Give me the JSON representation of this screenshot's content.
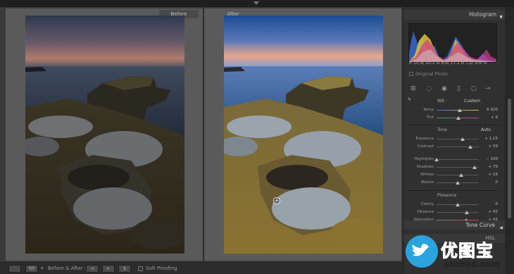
{
  "canvas": {
    "before_label": "Before",
    "after_label": "After"
  },
  "toolbar": {
    "view_mode_icon": "loupe-view-icon",
    "yy_label": "Y|Y",
    "before_after_label": "Before & After :",
    "swap_icons": [
      "copy-before-to-after-icon",
      "copy-after-to-before-icon",
      "swap-icon"
    ],
    "soft_proofing_label": "Soft Proofing"
  },
  "panel": {
    "histogram_title": "Histogram",
    "readout": "R  10,9/ 20,1  G  9,9/ 17,1  B  7,2/  9,6  %",
    "original_photo": "Original Photo",
    "wb_label": "WB :",
    "wb_value": "Custom",
    "temp_label": "Temp",
    "temp_value": "6 920",
    "tint_label": "Tint",
    "tint_value": "+ 9",
    "tone_title": "Tone",
    "tone_auto": "Auto",
    "exposure_label": "Exposure",
    "exposure_value": "+ 1,15",
    "contrast_label": "Contrast",
    "contrast_value": "+ 59",
    "highlights_label": "Highlights",
    "highlights_value": "− 100",
    "shadows_label": "Shadows",
    "shadows_value": "+ 79",
    "whites_label": "Whites",
    "whites_value": "+ 16",
    "blacks_label": "Blacks",
    "blacks_value": "0",
    "presence_title": "Presence",
    "clarity_label": "Clarity",
    "clarity_value": "0",
    "vibrance_label": "Vibrance",
    "vibrance_value": "+ 42",
    "saturation_label": "Saturation",
    "saturation_value": "+ 41",
    "tone_curve_title": "Tone Curve",
    "hsl_title": "HSL"
  },
  "sliders": {
    "temp": 0.55,
    "tint": 0.52,
    "exposure": 0.62,
    "contrast": 0.8,
    "highlights": 0.0,
    "shadows": 0.9,
    "whites": 0.58,
    "blacks": 0.5,
    "clarity": 0.5,
    "vibrance": 0.71,
    "saturation": 0.7
  },
  "watermark": {
    "text": "优图宝",
    "url": "utobao.com"
  },
  "colors": {
    "accent": "#2aa3df",
    "sky_after_top": "#1e5fae",
    "sky_sunset": "#e9a58a"
  }
}
